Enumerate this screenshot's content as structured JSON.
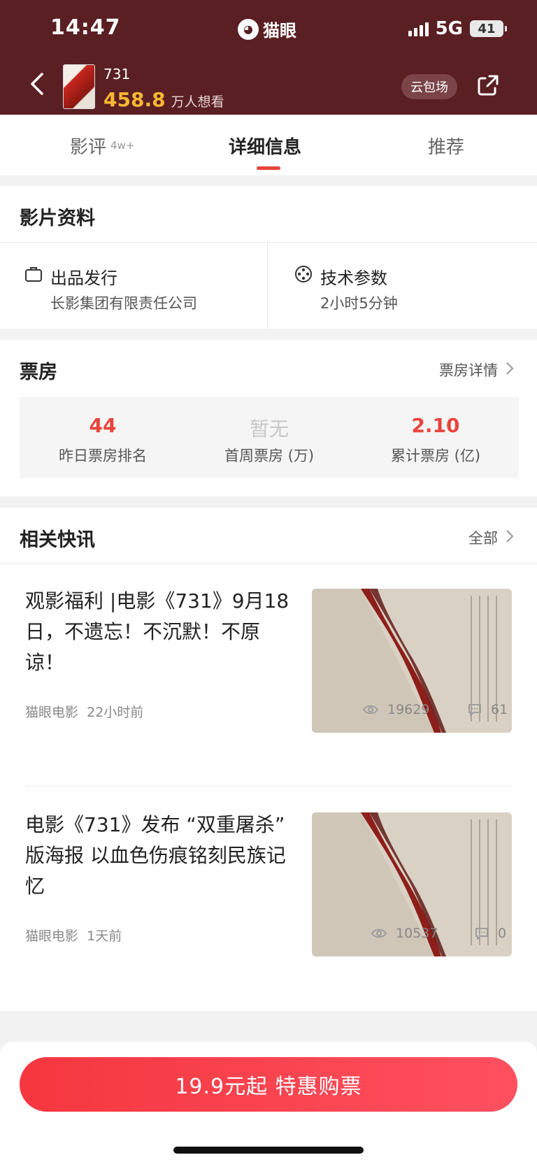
{
  "status_bar": {
    "time": "14:47",
    "app_name": "猫眼",
    "network": "5G",
    "battery": "41"
  },
  "header": {
    "movie_title": "731",
    "want_count": "458.8",
    "want_label": "万人想看",
    "private_screening": "云包场"
  },
  "tabs": {
    "review": "影评",
    "review_count": "4w+",
    "detail": "详细信息",
    "recommend": "推荐"
  },
  "film_info": {
    "title": "影片资料",
    "producer_label": "出品发行",
    "producer_value": "长影集团有限责任公司",
    "tech_label": "技术参数",
    "tech_value": "2小时5分钟"
  },
  "box_office": {
    "title": "票房",
    "link": "票房详情",
    "items": [
      {
        "value": "44",
        "label": "昨日票房排名"
      },
      {
        "value": "暂无",
        "label": "首周票房 (万)"
      },
      {
        "value": "2.10",
        "label": "累计票房 (亿)"
      }
    ]
  },
  "news": {
    "title": "相关快讯",
    "link": "全部",
    "items": [
      {
        "title": "观影福利 |电影《731》9月18日，不遗忘！不沉默！不原谅！",
        "source": "猫眼电影",
        "time": "22小时前",
        "views": "19629",
        "comments": "61"
      },
      {
        "title": "电影《731》发布 “双重屠杀” 版海报 以血色伤痕铭刻民族记忆",
        "source": "猫眼电影",
        "time": "1天前",
        "views": "10537",
        "comments": "0"
      }
    ]
  },
  "buy": {
    "label": "19.9元起 特惠购票"
  },
  "colors": {
    "header_bg": "#5a1f22",
    "accent": "#e8453c",
    "want_gold": "#f7b733"
  }
}
